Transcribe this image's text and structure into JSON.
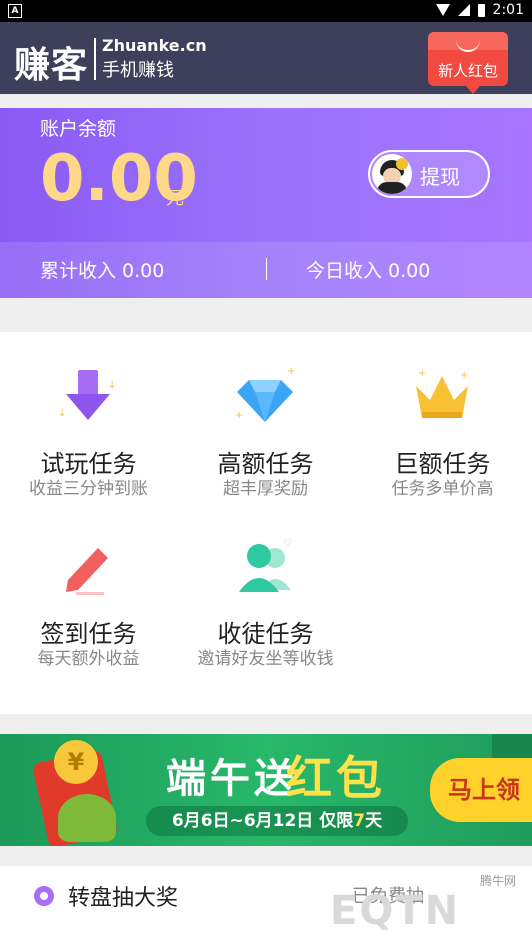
{
  "status_bar": {
    "left_icon": "A",
    "time": "2:01"
  },
  "header": {
    "logo_cn": "赚客",
    "logo_en": "Zhuanke.cn",
    "logo_sub": "手机赚钱",
    "newbie_button": "新人红包"
  },
  "balance": {
    "label": "账户余额",
    "amount": "0.00",
    "unit": "元",
    "withdraw_button": "提现",
    "cumulative_income": "累计收入 0.00",
    "today_income": "今日收入 0.00"
  },
  "tasks": [
    {
      "title": "试玩任务",
      "subtitle": "收益三分钟到账",
      "icon": "download-arrow-icon"
    },
    {
      "title": "高额任务",
      "subtitle": "超丰厚奖励",
      "icon": "diamond-icon"
    },
    {
      "title": "巨额任务",
      "subtitle": "任务多单价高",
      "icon": "crown-icon"
    },
    {
      "title": "签到任务",
      "subtitle": "每天额外收益",
      "icon": "pencil-icon"
    },
    {
      "title": "收徒任务",
      "subtitle": "邀请好友坐等收钱",
      "icon": "people-icon"
    }
  ],
  "banner": {
    "coin_symbol": "¥",
    "title_a": "端午送",
    "title_b": "红包",
    "date_text": "6月6日~6月12日 仅限",
    "date_highlight": "7",
    "date_tail": "天",
    "cta": "马上领"
  },
  "lottery": {
    "label": "转盘抽大奖",
    "right_text": "已免费抽",
    "watermark": "EQTN",
    "watermark_small": "腾牛网"
  },
  "colors": {
    "header_bg": "#3e3f5a",
    "balance_start": "#8a5af5",
    "balance_end": "#a775ff",
    "amount": "#fdd888",
    "banner_green": "#28b86a"
  }
}
